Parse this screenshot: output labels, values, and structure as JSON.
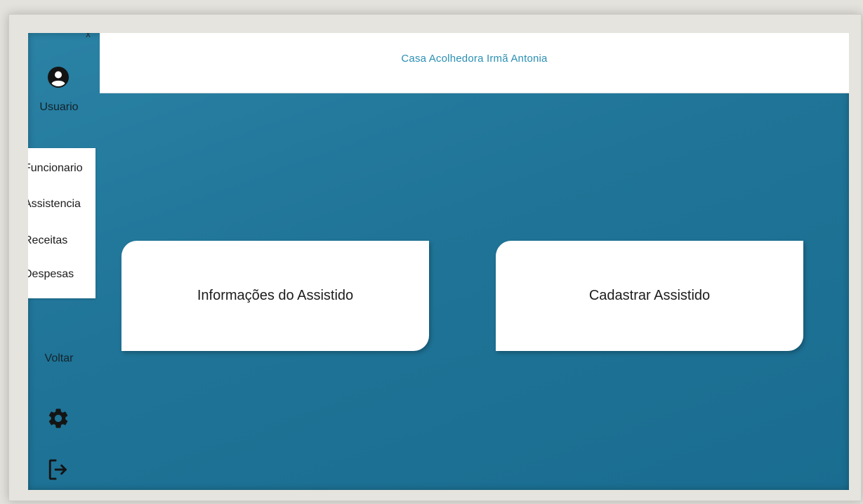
{
  "header": {
    "title": "Casa Acolhedora Irmã Antonia",
    "close_label": "x"
  },
  "sidebar": {
    "user_icon": "account-circle-icon",
    "user_label": "Usuario",
    "menu_items": [
      {
        "label": "Funcionario"
      },
      {
        "label": "Assistencia"
      },
      {
        "label": "Receitas"
      },
      {
        "label": "Despesas"
      }
    ],
    "back_label": "Voltar",
    "settings_icon": "gear-icon",
    "logout_icon": "logout-icon"
  },
  "main": {
    "cards": [
      {
        "label": "Informações do Assistido"
      },
      {
        "label": "Cadastrar Assistido"
      }
    ]
  },
  "colors": {
    "background": "#1f7497",
    "header_text": "#2a8fb3",
    "card": "#ffffff"
  }
}
